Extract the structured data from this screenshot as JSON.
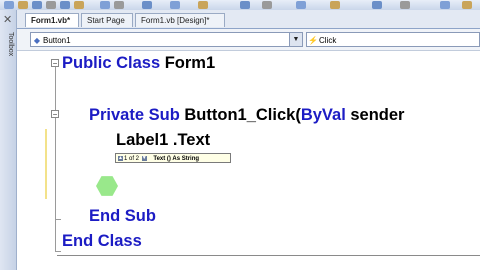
{
  "tabs": [
    {
      "label": "Form1.vb*",
      "active": true
    },
    {
      "label": "Start Page",
      "active": false
    },
    {
      "label": "Form1.vb [Design]*",
      "active": false
    }
  ],
  "toolbox": {
    "label": "Toolbox"
  },
  "dropdowns": {
    "object": "Button1",
    "event": "Click"
  },
  "code": {
    "line1_kw": "Public Class",
    "line1_name": "Form1",
    "line2_kw": "Private Sub",
    "line2_name": "Button1_Click(",
    "line2_kw2": "ByVal",
    "line2_rest": "sender",
    "line3": "Label1 .Text",
    "line4": "End Sub",
    "line5": "End Class"
  },
  "tooltip": {
    "counter": "1 of 2",
    "signature": "Text () As String"
  },
  "colors": {
    "keyword": "#1c1cc4",
    "plain": "#000000"
  }
}
